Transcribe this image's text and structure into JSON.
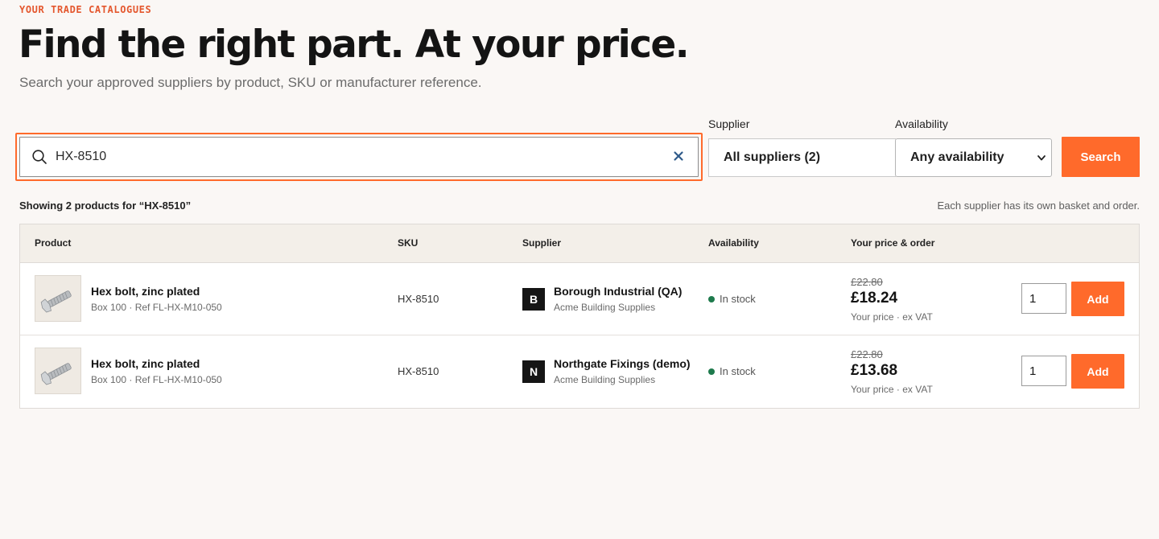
{
  "header": {
    "eyebrow": "YOUR TRADE CATALOGUES",
    "title": "Find the right part. At your price.",
    "subtitle": "Search your approved suppliers by product, SKU or manufacturer reference."
  },
  "search": {
    "value": "HX-8510",
    "icon": "search-icon",
    "clear_icon": "close-icon"
  },
  "filters": {
    "supplier_label": "Supplier",
    "supplier_value": "All suppliers (2)",
    "availability_label": "Availability",
    "availability_value": "Any availability",
    "search_button": "Search"
  },
  "results": {
    "summary": "Showing 2 products for “HX-8510”",
    "note": "Each supplier has its own basket and order."
  },
  "table": {
    "headers": [
      "Product",
      "SKU",
      "Supplier",
      "Availability",
      "Your price & order"
    ],
    "rows": [
      {
        "name": "Hex bolt, zinc plated",
        "meta": "Box 100 · Ref FL-HX-M10-050",
        "sku": "HX-8510",
        "supplier_initial": "B",
        "supplier_name": "Borough Industrial (QA)",
        "supplier_sub": "Acme Building Supplies",
        "availability": "In stock",
        "was_price": "£22.80",
        "price": "£18.24",
        "price_note": "Your price · ex VAT",
        "qty": "1",
        "add_label": "Add"
      },
      {
        "name": "Hex bolt, zinc plated",
        "meta": "Box 100 · Ref FL-HX-M10-050",
        "sku": "HX-8510",
        "supplier_initial": "N",
        "supplier_name": "Northgate Fixings (demo)",
        "supplier_sub": "Acme Building Supplies",
        "availability": "In stock",
        "was_price": "£22.80",
        "price": "£13.68",
        "price_note": "Your price · ex VAT",
        "qty": "1",
        "add_label": "Add"
      }
    ]
  },
  "colors": {
    "accent": "#ff6a2b",
    "eyebrow": "#e4572e",
    "in_stock": "#1e7a4c",
    "background": "#faf7f5"
  }
}
